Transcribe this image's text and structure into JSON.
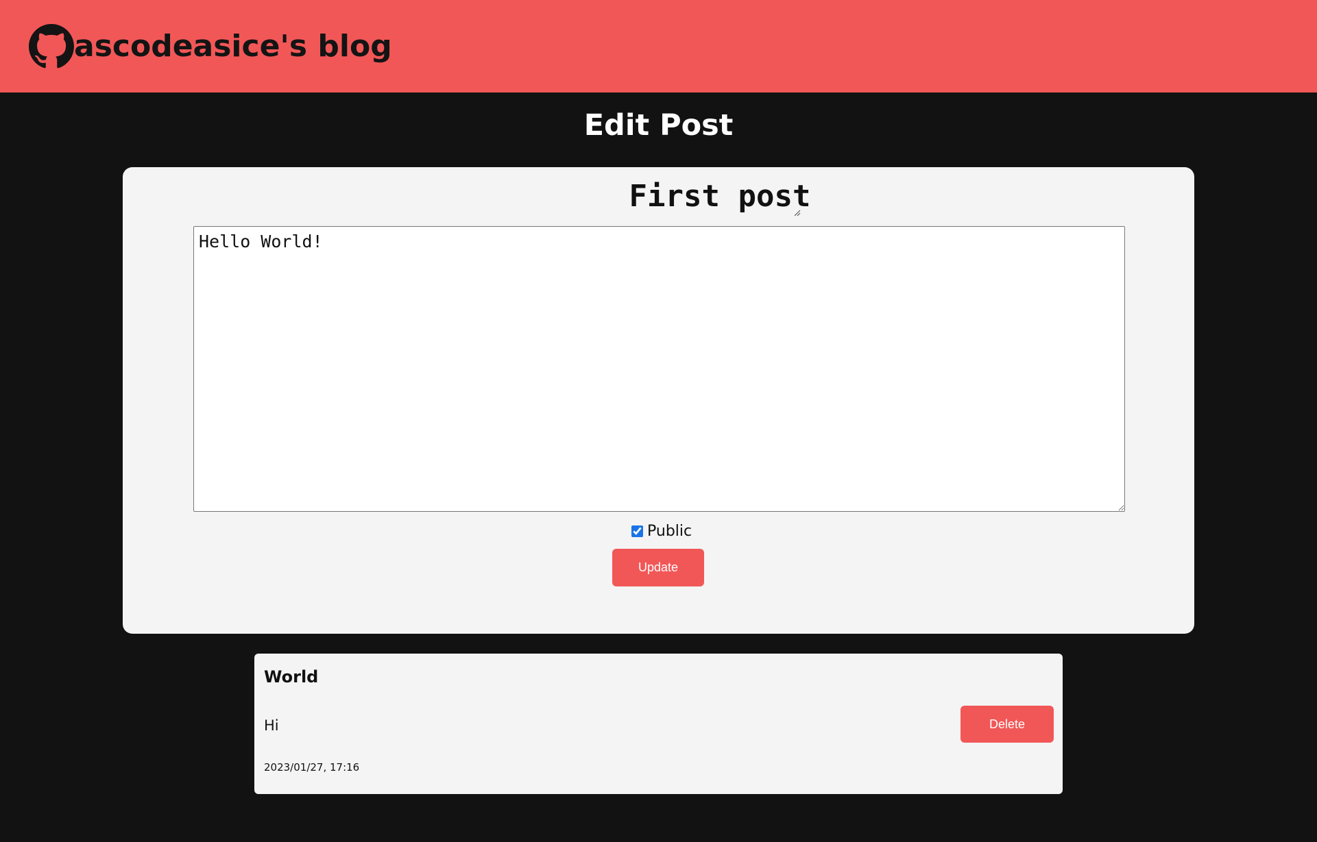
{
  "header": {
    "logo_icon": "github-icon",
    "site_title": "ascodeasice's blog",
    "bg_color": "#f25757"
  },
  "page": {
    "title": "Edit Post",
    "bg_color": "#121212"
  },
  "edit_form": {
    "title_value": "First post",
    "body_value": "Hello World!",
    "public_checked": true,
    "public_label": "Public",
    "update_label": "Update"
  },
  "comments": [
    {
      "author": "World",
      "text": "Hi",
      "date": "2023/01/27, 17:16",
      "delete_label": "Delete"
    }
  ],
  "accent_color": "#f25757"
}
